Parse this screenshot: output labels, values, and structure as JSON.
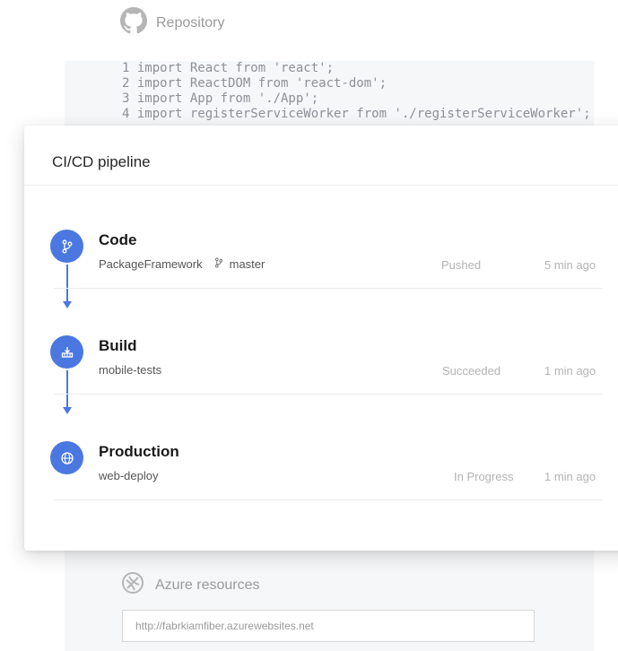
{
  "repository": {
    "title": "Repository",
    "code_lines": [
      "1 import React from 'react';",
      "2 import ReactDOM from 'react-dom';",
      "3 import App from './App';",
      "4 import registerServiceWorker from './registerServiceWorker';"
    ]
  },
  "pipeline": {
    "title": "CI/CD pipeline",
    "stages": [
      {
        "name": "Code",
        "subtitle": "PackageFramework",
        "branch": "master",
        "status": "Pushed",
        "time": "5 min ago",
        "icon": "git-branch-icon"
      },
      {
        "name": "Build",
        "subtitle": "mobile-tests",
        "status": "Succeeded",
        "time": "1 min ago",
        "icon": "build-icon"
      },
      {
        "name": "Production",
        "subtitle": "web-deploy",
        "status": "In Progress",
        "time": "1 min ago",
        "icon": "globe-icon"
      }
    ]
  },
  "azure": {
    "title": "Azure resources",
    "url": "http://fabrkiamfiber.azurewebsites.net"
  },
  "colors": {
    "accent": "#4a78e0",
    "muted": "#b3b3b3"
  }
}
